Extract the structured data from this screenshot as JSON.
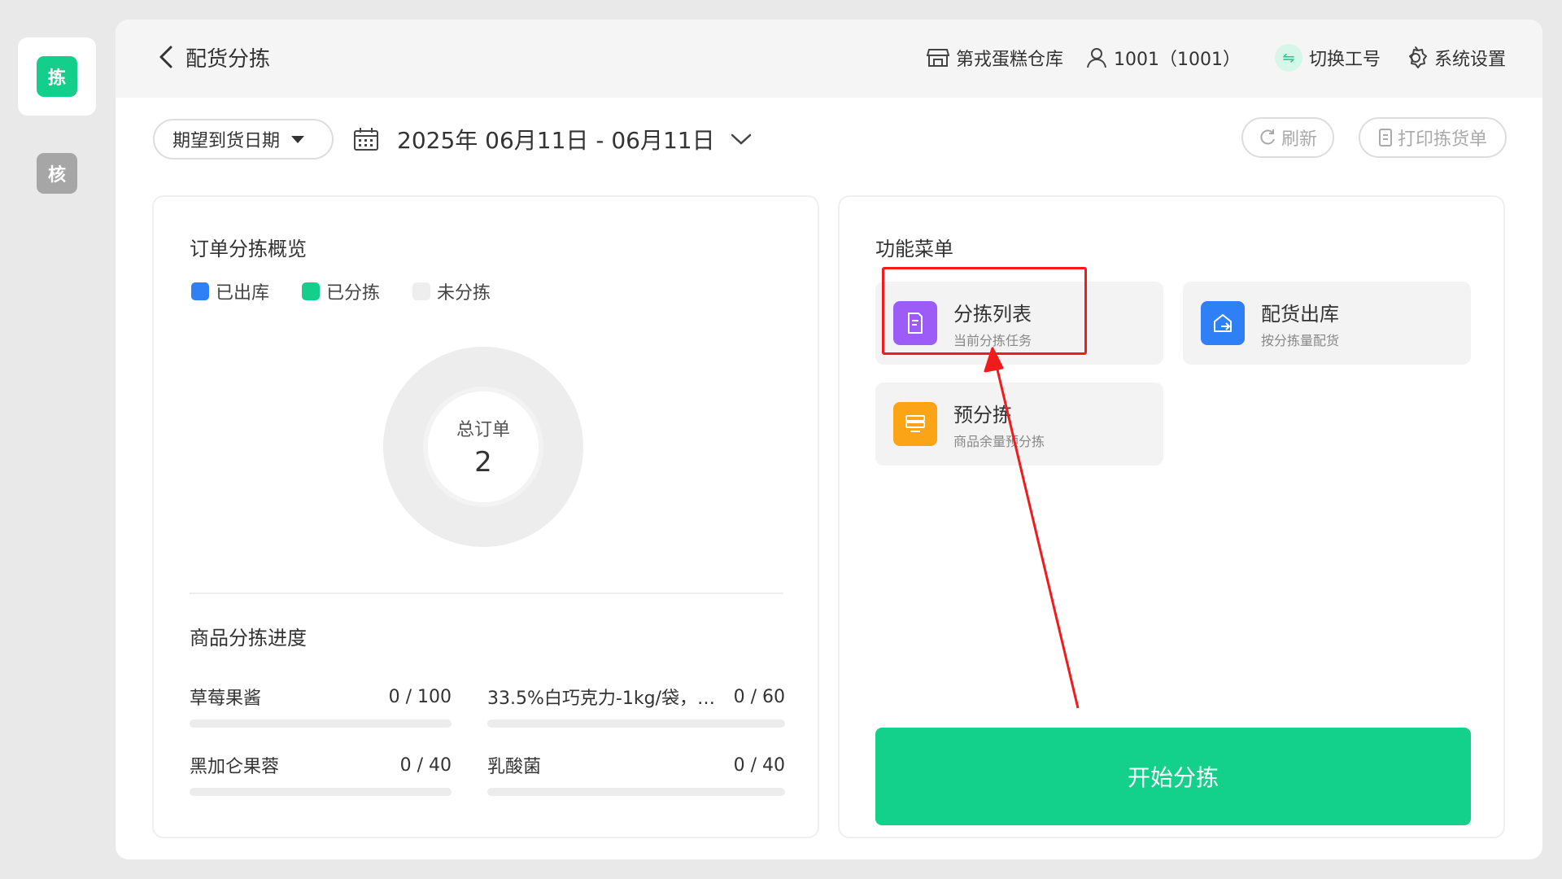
{
  "rail": {
    "active_label": "拣",
    "secondary_label": "核"
  },
  "header": {
    "back_title": "配货分拣",
    "warehouse": "第戎蛋糕仓库",
    "user": "1001（1001）",
    "switch_label": "切换工号",
    "settings_label": "系统设置"
  },
  "filters": {
    "date_type": "期望到货日期",
    "date_range": "2025年 06月11日 - 06月11日",
    "refresh_label": "刷新",
    "print_label": "打印拣货单"
  },
  "overview": {
    "title": "订单分拣概览",
    "legend": [
      {
        "label": "已出库",
        "color": "#2f7ff5"
      },
      {
        "label": "已分拣",
        "color": "#14cf8b"
      },
      {
        "label": "未分拣",
        "color": "#eeeeee"
      }
    ],
    "total_label": "总订单",
    "total_value": "2"
  },
  "progress": {
    "title": "商品分拣进度",
    "items": [
      {
        "name": "草莓果酱",
        "value": "0 / 100",
        "fraction": 0
      },
      {
        "name": "33.5%白巧克力-1kg/袋，1...",
        "value": "0 / 60",
        "fraction": 0
      },
      {
        "name": "黑加仑果蓉",
        "value": "0 / 40",
        "fraction": 0
      },
      {
        "name": "乳酸菌",
        "value": "0 / 40",
        "fraction": 0
      }
    ]
  },
  "menu": {
    "title": "功能菜单",
    "items": [
      {
        "name": "分拣列表",
        "sub": "当前分拣任务",
        "color": "#9d5cf6",
        "icon": "document-icon"
      },
      {
        "name": "配货出库",
        "sub": "按分拣量配货",
        "color": "#2f80f6",
        "icon": "box-out-icon"
      },
      {
        "name": "预分拣",
        "sub": "商品余量预分拣",
        "color": "#fba415",
        "icon": "stack-icon"
      }
    ],
    "start_label": "开始分拣"
  }
}
